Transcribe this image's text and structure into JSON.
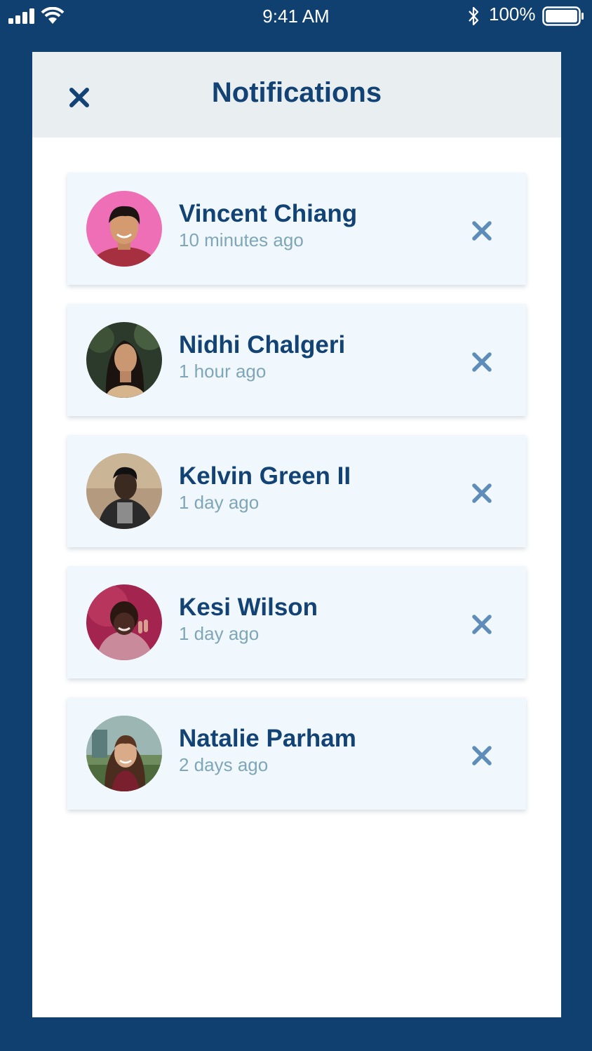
{
  "status_bar": {
    "time": "9:41 AM",
    "battery_percent": "100%",
    "icons": [
      "signal-icon",
      "wifi-icon",
      "bluetooth-icon",
      "battery-icon"
    ]
  },
  "header": {
    "title": "Notifications",
    "close_icon": "close-icon"
  },
  "colors": {
    "background": "#10406f",
    "header_bg": "#e9eef1",
    "card_bg": "#f1f8fd",
    "title": "#134274",
    "muted": "#7fa6b8",
    "dismiss": "#5f8db9"
  },
  "notifications": [
    {
      "name": "Vincent Chiang",
      "time": "10 minutes ago",
      "dismiss_icon": "close-icon"
    },
    {
      "name": "Nidhi Chalgeri",
      "time": "1 hour ago",
      "dismiss_icon": "close-icon"
    },
    {
      "name": "Kelvin Green II",
      "time": "1 day ago",
      "dismiss_icon": "close-icon"
    },
    {
      "name": "Kesi Wilson",
      "time": "1 day ago",
      "dismiss_icon": "close-icon"
    },
    {
      "name": "Natalie Parham",
      "time": "2 days ago",
      "dismiss_icon": "close-icon"
    }
  ]
}
